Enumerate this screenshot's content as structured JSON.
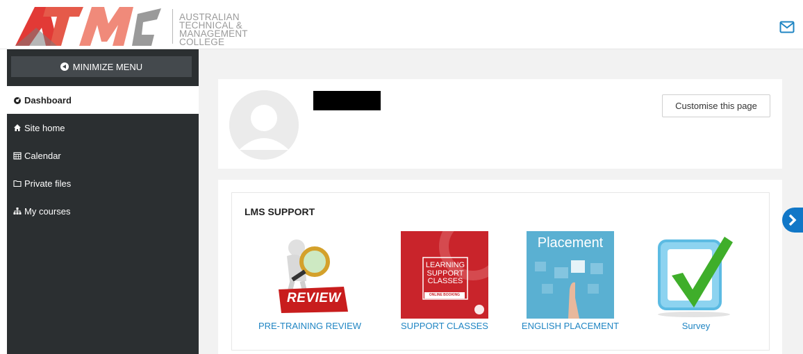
{
  "header": {
    "logo_mark": "ATMC",
    "logo_lines": [
      "AUSTRALIAN",
      "TECHNICAL &",
      "MANAGEMENT",
      "COLLEGE"
    ],
    "mail_icon": "envelope-icon"
  },
  "sidebar": {
    "minimize_label": "MINIMIZE MENU",
    "items": [
      {
        "label": "Dashboard",
        "icon": "dashboard-icon",
        "active": true
      },
      {
        "label": "Site home",
        "icon": "home-icon"
      },
      {
        "label": "Calendar",
        "icon": "calendar-icon"
      },
      {
        "label": "Private files",
        "icon": "folder-icon"
      },
      {
        "label": "My courses",
        "icon": "sitemap-icon"
      }
    ]
  },
  "main": {
    "customise_label": "Customise this page",
    "lms_title": "LMS SUPPORT",
    "tiles": [
      {
        "label": "PRE-TRAINING REVIEW",
        "image_text": "REVIEW"
      },
      {
        "label": "SUPPORT CLASSES",
        "image_lines": [
          "LEARNING",
          "SUPPORT",
          "CLASSES"
        ],
        "image_sub": "ONLINE BOOKING"
      },
      {
        "label": "ENGLISH PLACEMENT",
        "image_text": "Placement"
      },
      {
        "label": "Survey"
      }
    ]
  },
  "colors": {
    "accent": "#1f85c3",
    "sidebar": "#2b2f31",
    "brand_red": "#c8102e"
  }
}
